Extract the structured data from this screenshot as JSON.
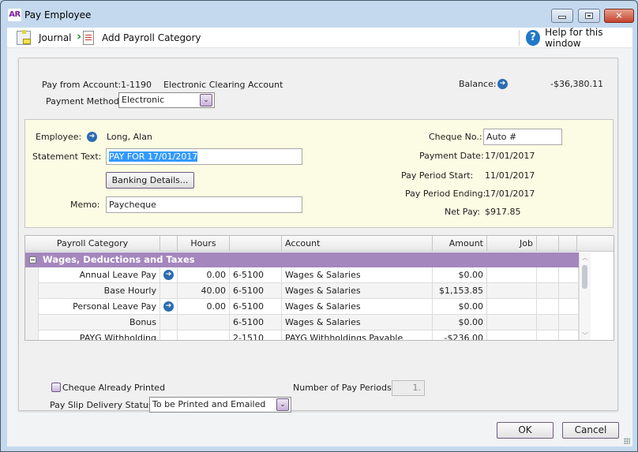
{
  "window": {
    "app_badge": "AR",
    "title": "Pay Employee",
    "controls": {
      "minimize": "minimize",
      "maximize": "maximize",
      "close": "✕"
    }
  },
  "toolbar": {
    "journal_label": "Journal",
    "add_payroll_category_label": "Add Payroll Category",
    "help_label": "Help for this window",
    "help_glyph": "?"
  },
  "payment": {
    "pay_from_account_label": "Pay from Account:",
    "account_number": "1-1190",
    "account_name": "Electronic Clearing Account",
    "payment_method_label": "Payment Method:",
    "payment_method_value": "Electronic",
    "balance_label": "Balance:",
    "balance_value": "-$36,380.11"
  },
  "employee": {
    "employee_label": "Employee:",
    "employee_name": "Long, Alan",
    "statement_text_label": "Statement Text:",
    "statement_text_value": "PAY FOR 17/01/2017",
    "banking_details_label": "Banking Details...",
    "memo_label": "Memo:",
    "memo_value": "Paycheque",
    "cheque_no_label": "Cheque No.:",
    "cheque_no_value": "Auto #",
    "payment_date_label": "Payment Date:",
    "payment_date_value": "17/01/2017",
    "pay_period_start_label": "Pay Period Start:",
    "pay_period_start_value": "11/01/2017",
    "pay_period_ending_label": "Pay Period Ending:",
    "pay_period_ending_value": "17/01/2017",
    "net_pay_label": "Net Pay:",
    "net_pay_value": "$917.85"
  },
  "grid": {
    "headers": [
      "Payroll Category",
      "",
      "Hours",
      "",
      "Account",
      "Amount",
      "Job",
      "",
      ""
    ],
    "group": {
      "toggle": "−",
      "label": "Wages, Deductions and Taxes",
      "color": "#a487bd"
    },
    "rows": [
      {
        "category": "Annual Leave Pay",
        "has_detail": true,
        "hours": "0.00",
        "account_no": "6-5100",
        "account": "Wages & Salaries",
        "amount": "$0.00",
        "job": ""
      },
      {
        "category": "Base Hourly",
        "has_detail": false,
        "hours": "40.00",
        "account_no": "6-5100",
        "account": "Wages & Salaries",
        "amount": "$1,153.85",
        "job": ""
      },
      {
        "category": "Personal Leave Pay",
        "has_detail": true,
        "hours": "0.00",
        "account_no": "6-5100",
        "account": "Wages & Salaries",
        "amount": "$0.00",
        "job": ""
      },
      {
        "category": "Bonus",
        "has_detail": false,
        "hours": "",
        "account_no": "6-5100",
        "account": "Wages & Salaries",
        "amount": "$0.00",
        "job": ""
      },
      {
        "category": "PAYG Withholding",
        "has_detail": false,
        "hours": "",
        "account_no": "2-1510",
        "account": "PAYG Withholdings Payable",
        "amount": "-$236.00",
        "job": ""
      }
    ]
  },
  "bottom": {
    "cheque_printed_label": "Cheque Already Printed",
    "cheque_printed_checked": false,
    "num_pay_periods_label": "Number of Pay Periods:",
    "num_pay_periods_value": "1.",
    "delivery_status_label": "Pay Slip Delivery Status:",
    "delivery_status_value": "To be Printed and Emailed"
  },
  "footer": {
    "ok_label": "OK",
    "cancel_label": "Cancel"
  },
  "icons": {
    "arrow": "➔",
    "dropdown": "⌄",
    "scroll_up": "︿",
    "scroll_down": "﹀"
  }
}
